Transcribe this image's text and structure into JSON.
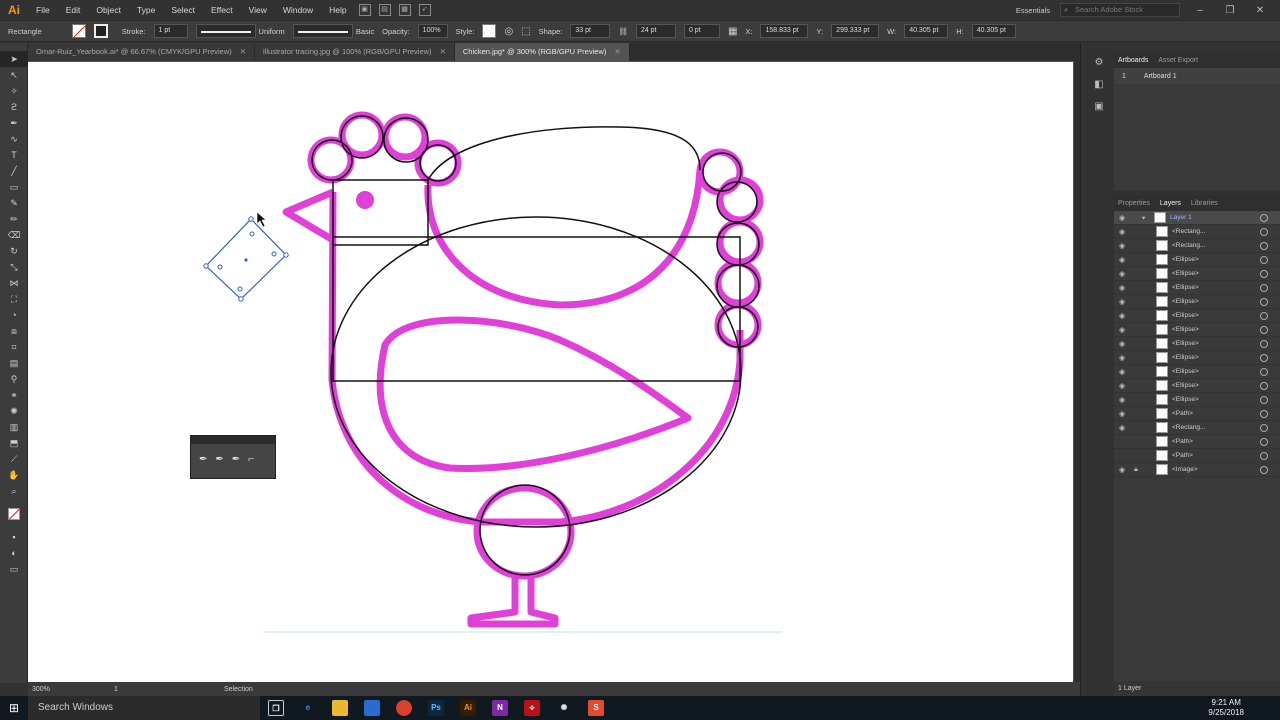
{
  "app": {
    "logo": "Ai"
  },
  "menu": [
    "File",
    "Edit",
    "Object",
    "Type",
    "Select",
    "Effect",
    "View",
    "Window",
    "Help"
  ],
  "menu_right": {
    "workspace": "Essentials",
    "search_placeholder": "Search Adobe Stock"
  },
  "control": {
    "tool_name": "Rectangle",
    "stroke_label": "Stroke:",
    "stroke_value": "1 pt",
    "profile": "Uniform",
    "brush": "Basic",
    "opacity_label": "Opacity:",
    "opacity_value": "100%",
    "style_label": "Style:",
    "shape_label": "Shape:",
    "width_value": "33 pt",
    "height_value": "24 pt",
    "corner_value": "0 pt",
    "x_label": "X:",
    "x_value": "158.833 pt",
    "y_label": "Y:",
    "y_value": "299.333 pt",
    "w_label": "W:",
    "w_value": "40.305 pt",
    "h_label": "H:",
    "h_value": "40.305 pt"
  },
  "tabs": [
    {
      "label": "Omar-Ruiz_Yearbook.ai* @ 66.67% (CMYK/GPU Preview)",
      "active": false
    },
    {
      "label": "illustrator tracing.jpg @ 100% (RGB/GPU Preview)",
      "active": false
    },
    {
      "label": "Chicken.jpg* @ 300% (RGB/GPU Preview)",
      "active": true
    }
  ],
  "status": {
    "zoom": "300%",
    "artboard_num": "1",
    "tool": "Selection"
  },
  "artboards_panel": {
    "tabs": [
      "Artboards",
      "Asset Export"
    ],
    "rows": [
      {
        "num": "1",
        "name": "Artboard 1"
      }
    ]
  },
  "layers_panel": {
    "tabs": [
      "Properties",
      "Layers",
      "Libraries"
    ],
    "layer_name": "Layer 1",
    "items": [
      "<Rectang...",
      "<Rectang...",
      "<Ellipse>",
      "<Ellipse>",
      "<Ellipse>",
      "<Ellipse>",
      "<Ellipse>",
      "<Ellipse>",
      "<Ellipse>",
      "<Ellipse>",
      "<Ellipse>",
      "<Ellipse>",
      "<Ellipse>",
      "<Path>",
      "<Rectang...",
      "<Path>",
      "<Path>",
      "<Image>"
    ],
    "footer": "1 Layer"
  },
  "taskbar": {
    "search": "Search Windows",
    "time": "9:21 AM",
    "date": "9/25/2018"
  },
  "colors": {
    "magenta": "#e040d8",
    "selection": "#3060c8",
    "ui_bg": "#323232"
  }
}
